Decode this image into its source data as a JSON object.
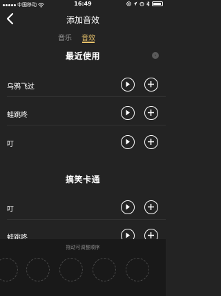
{
  "status_bar": {
    "carrier": "中国移动",
    "time": "16:49"
  },
  "nav": {
    "title": "添加音效"
  },
  "tabs": [
    {
      "label": "音乐"
    },
    {
      "label": "音效"
    }
  ],
  "sections": [
    {
      "title": "最近使用",
      "items": [
        {
          "name": "乌鸦飞过"
        },
        {
          "name": "蛙跳咚"
        },
        {
          "name": "叮"
        }
      ]
    },
    {
      "title": "搞笑卡通",
      "items": [
        {
          "name": "叮"
        },
        {
          "name": "蛙跳咚"
        }
      ]
    }
  ],
  "bottom_panel": {
    "hint": "拖动可调整顺序"
  },
  "colors": {
    "background": "#232323",
    "accent": "#e8c26a",
    "panel": "#191919"
  }
}
